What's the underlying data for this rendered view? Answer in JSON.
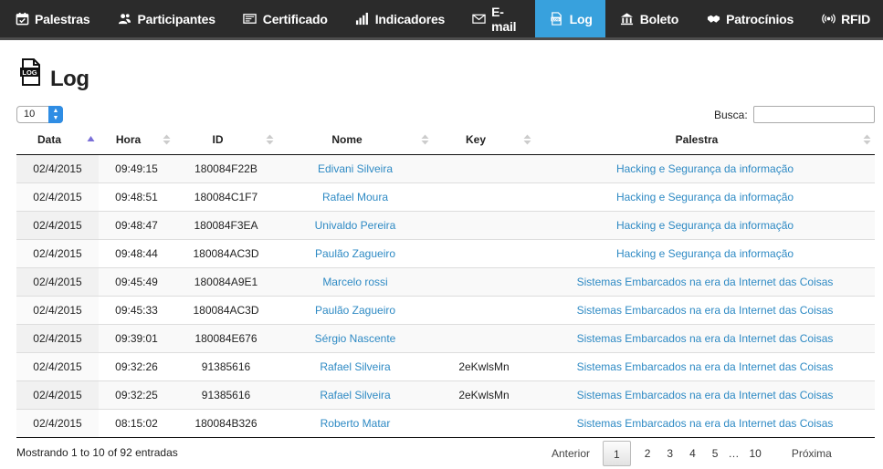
{
  "nav": {
    "items": [
      {
        "label": "Palestras",
        "icon": "calendar-icon",
        "active": false
      },
      {
        "label": "Participantes",
        "icon": "users-icon",
        "active": false
      },
      {
        "label": "Certificado",
        "icon": "certificate-icon",
        "active": false
      },
      {
        "label": "Indicadores",
        "icon": "bar-chart-icon",
        "active": false
      },
      {
        "label": "E-mail",
        "icon": "envelope-icon",
        "active": false
      },
      {
        "label": "Log",
        "icon": "log-file-icon",
        "active": true
      },
      {
        "label": "Boleto",
        "icon": "bank-icon",
        "active": false
      },
      {
        "label": "Patrocínios",
        "icon": "handshake-icon",
        "active": false
      },
      {
        "label": "RFID",
        "icon": "rfid-icon",
        "active": false
      }
    ],
    "active_color": "#38a1dd",
    "bar_color": "#2b2b2b"
  },
  "page": {
    "title": "Log",
    "icon": "log-file-icon"
  },
  "controls": {
    "length_value": "10",
    "search_label": "Busca:",
    "search_value": ""
  },
  "table": {
    "columns": [
      "Data",
      "Hora",
      "ID",
      "Nome",
      "Key",
      "Palestra"
    ],
    "sorted_column": "Data",
    "sort_direction": "asc",
    "rows": [
      {
        "data": "02/4/2015",
        "hora": "09:49:15",
        "id": "180084F22B",
        "nome": "Edivani Silveira",
        "key": "",
        "palestra": "Hacking e Segurança da informação"
      },
      {
        "data": "02/4/2015",
        "hora": "09:48:51",
        "id": "180084C1F7",
        "nome": "Rafael Moura",
        "key": "",
        "palestra": "Hacking e Segurança da informação"
      },
      {
        "data": "02/4/2015",
        "hora": "09:48:47",
        "id": "180084F3EA",
        "nome": "Univaldo Pereira",
        "key": "",
        "palestra": "Hacking e Segurança da informação"
      },
      {
        "data": "02/4/2015",
        "hora": "09:48:44",
        "id": "180084AC3D",
        "nome": "Paulão Zagueiro",
        "key": "",
        "palestra": "Hacking e Segurança da informação"
      },
      {
        "data": "02/4/2015",
        "hora": "09:45:49",
        "id": "180084A9E1",
        "nome": "Marcelo rossi",
        "key": "",
        "palestra": "Sistemas Embarcados na era da Internet das Coisas"
      },
      {
        "data": "02/4/2015",
        "hora": "09:45:33",
        "id": "180084AC3D",
        "nome": "Paulão Zagueiro",
        "key": "",
        "palestra": "Sistemas Embarcados na era da Internet das Coisas"
      },
      {
        "data": "02/4/2015",
        "hora": "09:39:01",
        "id": "180084E676",
        "nome": "Sérgio Nascente",
        "key": "",
        "palestra": "Sistemas Embarcados na era da Internet das Coisas"
      },
      {
        "data": "02/4/2015",
        "hora": "09:32:26",
        "id": "91385616",
        "nome": "Rafael Silveira",
        "key": "2eKwlsMn",
        "palestra": "Sistemas Embarcados na era da Internet das Coisas"
      },
      {
        "data": "02/4/2015",
        "hora": "09:32:25",
        "id": "91385616",
        "nome": "Rafael Silveira",
        "key": "2eKwlsMn",
        "palestra": "Sistemas Embarcados na era da Internet das Coisas"
      },
      {
        "data": "02/4/2015",
        "hora": "08:15:02",
        "id": "180084B326",
        "nome": "Roberto Matar",
        "key": "",
        "palestra": "Sistemas Embarcados na era da Internet das Coisas"
      }
    ],
    "link_color": "#2e8ac4"
  },
  "footer": {
    "info": "Mostrando 1 to 10 of 92 entradas",
    "prev_label": "Anterior",
    "next_label": "Próxima",
    "pages": [
      "1",
      "2",
      "3",
      "4",
      "5",
      "…",
      "10"
    ],
    "current_page": "1"
  }
}
